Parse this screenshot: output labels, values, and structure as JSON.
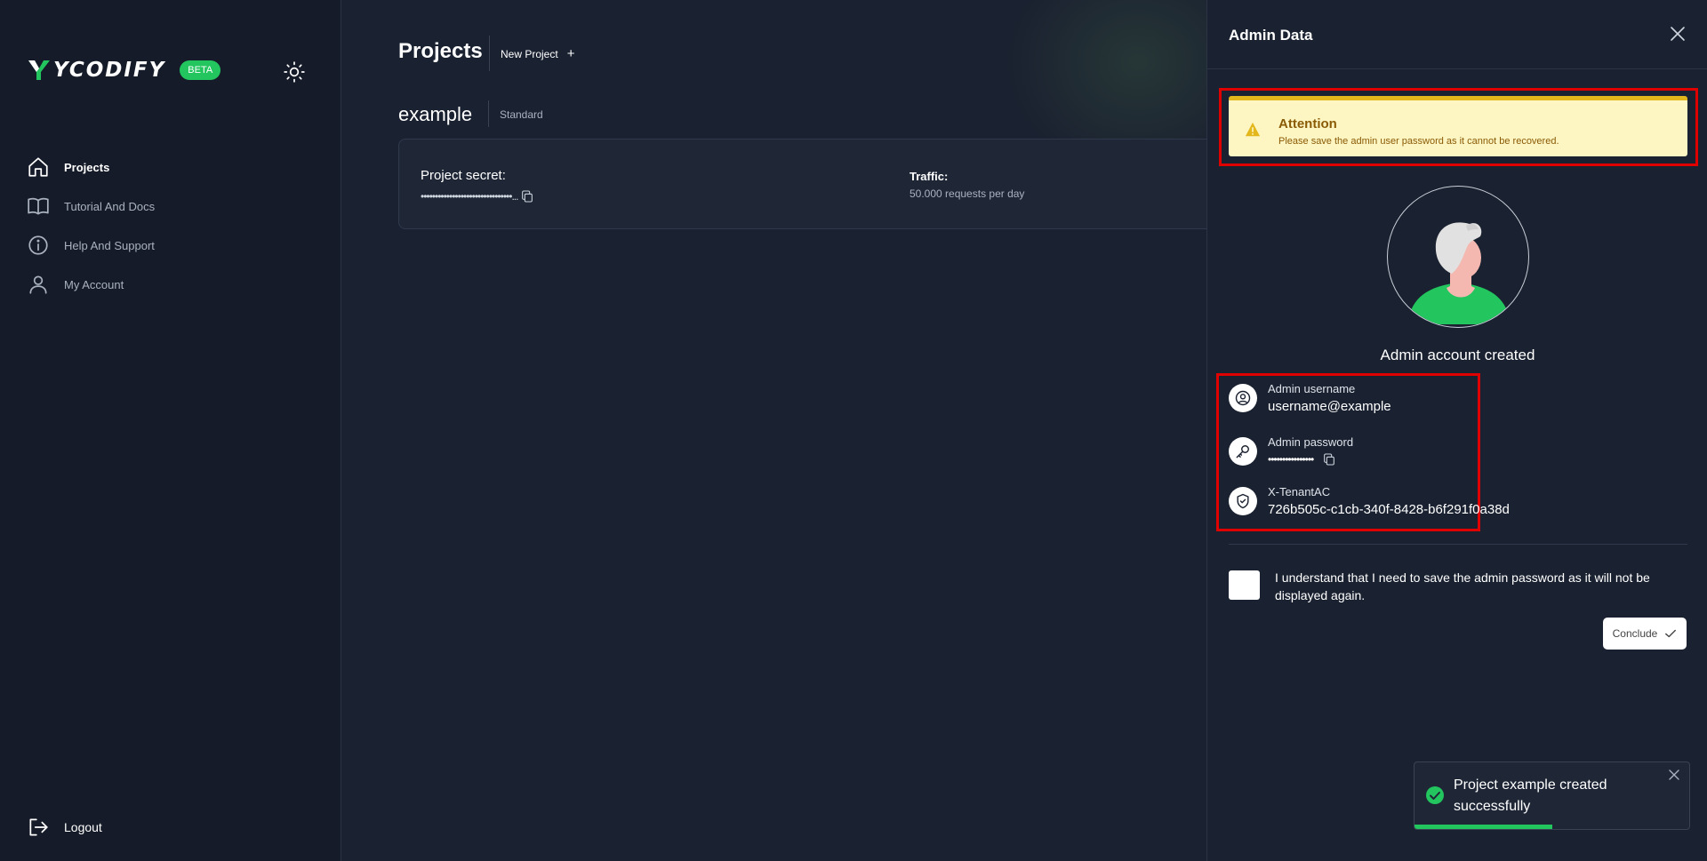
{
  "sidebar": {
    "brand": "YCODIFY",
    "beta_badge": "BETA",
    "items": [
      {
        "label": "Projects",
        "icon": "home-icon",
        "active": true
      },
      {
        "label": "Tutorial And Docs",
        "icon": "book-icon"
      },
      {
        "label": "Help And Support",
        "icon": "info-icon"
      },
      {
        "label": "My Account",
        "icon": "user-icon"
      }
    ],
    "logout_label": "Logout"
  },
  "header": {
    "title": "Projects",
    "new_project_label": "New Project",
    "new_project_icon": "+"
  },
  "project": {
    "name": "example",
    "plan": "Standard",
    "secret_label": "Project secret:",
    "secret_value": "••••••••••••••••••••••••••••••••...",
    "traffic_label": "Traffic:",
    "traffic_value": "50.000 requests per day"
  },
  "drawer": {
    "title": "Admin Data",
    "alert": {
      "title": "Attention",
      "text": "Please save the admin user password as it cannot be recovered.",
      "color": "#fdf6c3"
    },
    "created_title": "Admin account created",
    "credentials": {
      "username_label": "Admin username",
      "username_value": "username@example",
      "password_label": "Admin password",
      "password_value": "••••••••••••••••",
      "tenant_label": "X-TenantAC",
      "tenant_value": "726b505c-c1cb-340f-8428-b6f291f0a38d"
    },
    "confirm_text": "I understand that I need to save the admin password as it will not be displayed again.",
    "conclude_label": "Conclude"
  },
  "toast": {
    "message": "Project example created successfully",
    "progress": 0.5,
    "color": "#22c55e"
  },
  "colors": {
    "accent": "#22c55e",
    "background": "#1a2130",
    "highlight": "#e00000"
  }
}
